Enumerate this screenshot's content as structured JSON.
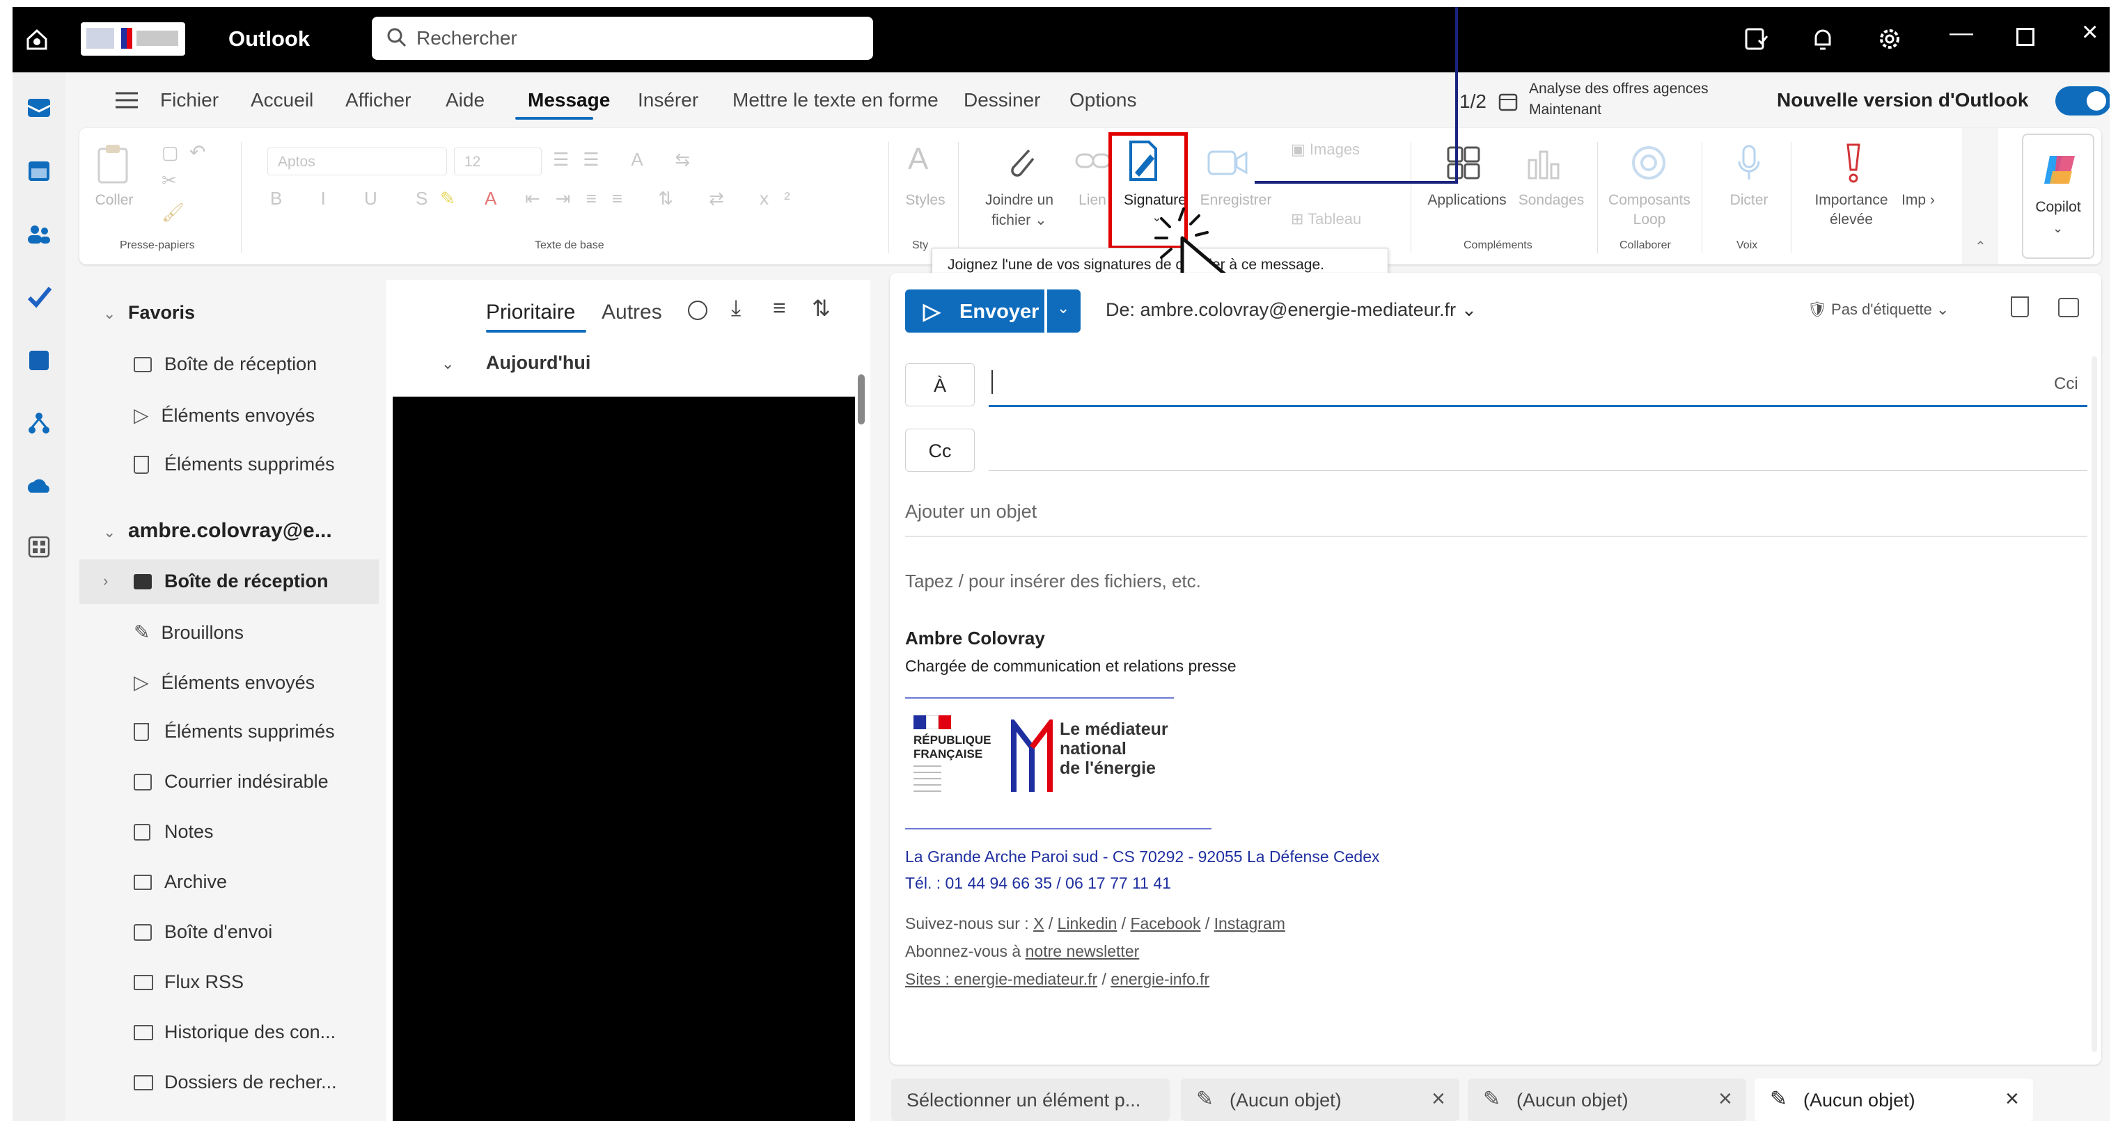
{
  "titlebar": {
    "app_name": "Outlook",
    "search_placeholder": "Rechercher"
  },
  "tabs": [
    {
      "label": "Fichier"
    },
    {
      "label": "Accueil"
    },
    {
      "label": "Afficher"
    },
    {
      "label": "Aide"
    },
    {
      "label": "Message"
    },
    {
      "label": "Insérer"
    },
    {
      "label": "Mettre le texte en forme"
    },
    {
      "label": "Dessiner"
    },
    {
      "label": "Options"
    }
  ],
  "header_right": {
    "pager": "1/2",
    "reminder_title": "Analyse des offres agences",
    "reminder_time": "Maintenant",
    "new_outlook_label": "Nouvelle version d'Outlook",
    "new_outlook_on": true
  },
  "ribbon": {
    "paste": "Coller",
    "clipboard_group": "Presse-papiers",
    "font_name": "Aptos",
    "font_size": "12",
    "basic_text_group": "Texte de base",
    "styles": "Styles",
    "attach_line1": "Joindre un",
    "attach_line2": "fichier",
    "link": "Lien",
    "signature": "Signature",
    "record": "Enregistrer",
    "images": "Images",
    "table": "Tableau",
    "applications": "Applications",
    "polls": "Sondages",
    "addins_group": "Compléments",
    "loop_line1": "Composants",
    "loop_line2": "Loop",
    "collaborate_group": "Collaborer",
    "dictate": "Dicter",
    "voice_group": "Voix",
    "importance_line1": "Importance",
    "importance_line2": "élevée",
    "importance_cut": "Imp",
    "copilot": "Copilot",
    "tooltip": "Joignez l'une de vos signatures de courrier à ce message."
  },
  "folders": {
    "favorites_header": "Favoris",
    "favorites": [
      "Boîte de réception",
      "Éléments envoyés",
      "Éléments supprimés"
    ],
    "account": "ambre.colovray@e...",
    "account_items": [
      "Boîte de réception",
      "Brouillons",
      "Éléments envoyés",
      "Éléments supprimés",
      "Courrier indésirable",
      "Notes",
      "Archive",
      "Boîte d'envoi",
      "Flux RSS",
      "Historique des con...",
      "Dossiers de recher..."
    ]
  },
  "msglist": {
    "focused": "Prioritaire",
    "other": "Autres",
    "group_today": "Aujourd'hui"
  },
  "compose": {
    "send": "Envoyer",
    "from": "De: ambre.colovray@energie-mediateur.fr",
    "label": "Pas d'étiquette",
    "to": "À",
    "bcc": "Cci",
    "cc": "Cc",
    "subject_placeholder": "Ajouter un objet",
    "body_placeholder": "Tapez / pour insérer des fichiers, etc.",
    "signature": {
      "name": "Ambre Colovray",
      "role": "Chargée de communication et relations presse",
      "logo_rf_line1": "RÉPUBLIQUE",
      "logo_rf_line2": "FRANÇAISE",
      "logo_med_line1": "Le médiateur",
      "logo_med_line2": "national",
      "logo_med_line3": "de l'énergie",
      "address": "La Grande Arche Paroi sud - CS 70292 - 92055 La Défense Cedex",
      "phone": "Tél. : 01 44 94 66 35 / 06 17 77 11 41",
      "follow_prefix": "Suivez-nous sur :",
      "follow_x": "X",
      "follow_linkedin": "Linkedin",
      "follow_facebook": "Facebook",
      "follow_instagram": "Instagram",
      "newsletter_prefix": "Abonnez-vous à",
      "newsletter_link": "notre newsletter",
      "sites_link1": "Sites : energie-mediateur.fr",
      "sites_link2": "energie-info.fr"
    }
  },
  "bottom_tabs": [
    {
      "label": "Sélectionner un élément p..."
    },
    {
      "label": "(Aucun objet)"
    },
    {
      "label": "(Aucun objet)"
    },
    {
      "label": "(Aucun objet)"
    }
  ],
  "colors": {
    "accent": "#0f6cbd",
    "highlight_box": "#e00000",
    "annotation_line": "#1a237e"
  }
}
